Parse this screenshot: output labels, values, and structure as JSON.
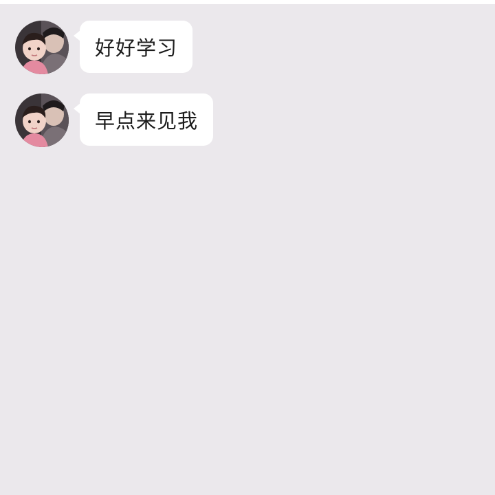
{
  "messages": [
    {
      "sender_avatar": "avatar-icon",
      "text": "好好学习"
    },
    {
      "sender_avatar": "avatar-icon",
      "text": "早点来见我"
    }
  ],
  "colors": {
    "background": "#ebe8ec",
    "bubble": "#ffffff",
    "text": "#1c1c1c"
  }
}
